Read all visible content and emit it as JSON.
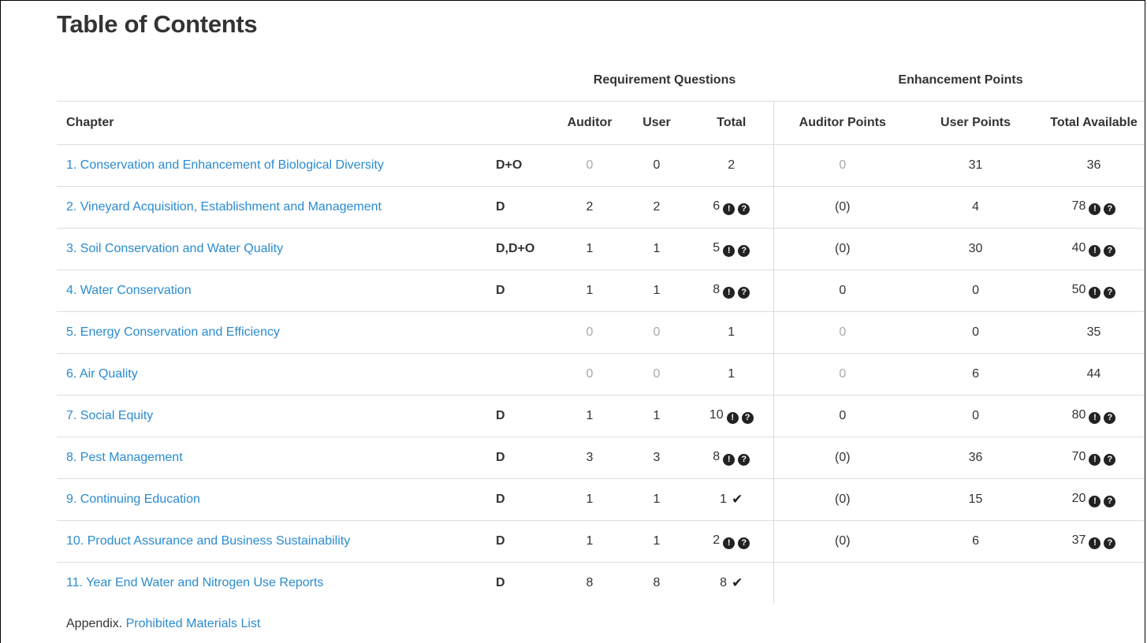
{
  "page": {
    "title": "Table of Contents"
  },
  "groups": {
    "requirement": "Requirement Questions",
    "enhancement": "Enhancement Points"
  },
  "columns": {
    "chapter": "Chapter",
    "auditor": "Auditor",
    "user": "User",
    "total": "Total",
    "auditor_points": "Auditor Points",
    "user_points": "User Points",
    "total_available": "Total Available"
  },
  "rows": [
    {
      "num": "1.",
      "title": "Conservation and Enhancement of Biological Diversity",
      "cat": "D+O",
      "auditor": {
        "v": "0",
        "muted": true
      },
      "user": {
        "v": "0",
        "muted": false
      },
      "total": {
        "v": "2",
        "icons": []
      },
      "aud_pts": {
        "v": "0",
        "muted": true
      },
      "user_pts": "31",
      "tot_av": {
        "v": "36",
        "icons": []
      }
    },
    {
      "num": "2.",
      "title": "Vineyard Acquisition, Establishment and Management",
      "cat": "D",
      "auditor": {
        "v": "2",
        "muted": false
      },
      "user": {
        "v": "2",
        "muted": false
      },
      "total": {
        "v": "6",
        "icons": [
          "exclamation-icon",
          "question-icon"
        ]
      },
      "aud_pts": {
        "v": "(0)",
        "muted": false
      },
      "user_pts": "4",
      "tot_av": {
        "v": "78",
        "icons": [
          "exclamation-icon",
          "question-icon"
        ]
      }
    },
    {
      "num": "3.",
      "title": "Soil Conservation and Water Quality",
      "cat": "D,D+O",
      "auditor": {
        "v": "1",
        "muted": false
      },
      "user": {
        "v": "1",
        "muted": false
      },
      "total": {
        "v": "5",
        "icons": [
          "exclamation-icon",
          "question-icon"
        ]
      },
      "aud_pts": {
        "v": "(0)",
        "muted": false
      },
      "user_pts": "30",
      "tot_av": {
        "v": "40",
        "icons": [
          "exclamation-icon",
          "question-icon"
        ]
      }
    },
    {
      "num": "4.",
      "title": "Water Conservation",
      "cat": "D",
      "auditor": {
        "v": "1",
        "muted": false
      },
      "user": {
        "v": "1",
        "muted": false
      },
      "total": {
        "v": "8",
        "icons": [
          "exclamation-icon",
          "question-icon"
        ]
      },
      "aud_pts": {
        "v": "0",
        "muted": false
      },
      "user_pts": "0",
      "tot_av": {
        "v": "50",
        "icons": [
          "exclamation-icon",
          "question-icon"
        ]
      }
    },
    {
      "num": "5.",
      "title": "Energy Conservation and Efficiency",
      "cat": "",
      "auditor": {
        "v": "0",
        "muted": true
      },
      "user": {
        "v": "0",
        "muted": true
      },
      "total": {
        "v": "1",
        "icons": []
      },
      "aud_pts": {
        "v": "0",
        "muted": true
      },
      "user_pts": "0",
      "tot_av": {
        "v": "35",
        "icons": []
      }
    },
    {
      "num": "6.",
      "title": "Air Quality",
      "cat": "",
      "auditor": {
        "v": "0",
        "muted": true
      },
      "user": {
        "v": "0",
        "muted": true
      },
      "total": {
        "v": "1",
        "icons": []
      },
      "aud_pts": {
        "v": "0",
        "muted": true
      },
      "user_pts": "6",
      "tot_av": {
        "v": "44",
        "icons": []
      }
    },
    {
      "num": "7.",
      "title": "Social Equity",
      "cat": "D",
      "auditor": {
        "v": "1",
        "muted": false
      },
      "user": {
        "v": "1",
        "muted": false
      },
      "total": {
        "v": "10",
        "icons": [
          "exclamation-icon",
          "question-icon"
        ]
      },
      "aud_pts": {
        "v": "0",
        "muted": false
      },
      "user_pts": "0",
      "tot_av": {
        "v": "80",
        "icons": [
          "exclamation-icon",
          "question-icon"
        ]
      }
    },
    {
      "num": "8.",
      "title": "Pest Management",
      "cat": "D",
      "auditor": {
        "v": "3",
        "muted": false
      },
      "user": {
        "v": "3",
        "muted": false
      },
      "total": {
        "v": "8",
        "icons": [
          "exclamation-icon",
          "question-icon"
        ]
      },
      "aud_pts": {
        "v": "(0)",
        "muted": false
      },
      "user_pts": "36",
      "tot_av": {
        "v": "70",
        "icons": [
          "exclamation-icon",
          "question-icon"
        ]
      }
    },
    {
      "num": "9.",
      "title": "Continuing Education",
      "cat": "D",
      "auditor": {
        "v": "1",
        "muted": false
      },
      "user": {
        "v": "1",
        "muted": false
      },
      "total": {
        "v": "1",
        "icons": [
          "check-icon"
        ]
      },
      "aud_pts": {
        "v": "(0)",
        "muted": false
      },
      "user_pts": "15",
      "tot_av": {
        "v": "20",
        "icons": [
          "exclamation-icon",
          "question-icon"
        ]
      }
    },
    {
      "num": "10.",
      "title": "Product Assurance and Business Sustainability",
      "cat": "D",
      "auditor": {
        "v": "1",
        "muted": false
      },
      "user": {
        "v": "1",
        "muted": false
      },
      "total": {
        "v": "2",
        "icons": [
          "exclamation-icon",
          "question-icon"
        ]
      },
      "aud_pts": {
        "v": "(0)",
        "muted": false
      },
      "user_pts": "6",
      "tot_av": {
        "v": "37",
        "icons": [
          "exclamation-icon",
          "question-icon"
        ]
      }
    },
    {
      "num": "11.",
      "title": "Year End Water and Nitrogen Use Reports",
      "cat": "D",
      "auditor": {
        "v": "8",
        "muted": false
      },
      "user": {
        "v": "8",
        "muted": false
      },
      "total": {
        "v": "8",
        "icons": [
          "check-icon"
        ]
      },
      "aud_pts": {
        "v": "",
        "muted": false
      },
      "user_pts": "",
      "tot_av": {
        "v": "",
        "icons": []
      }
    }
  ],
  "appendix": {
    "label": "Appendix.",
    "link": "Prohibited Materials List"
  },
  "colors": {
    "link": "#2a8bd0",
    "muted": "#aaaaaa",
    "border": "#dddddd"
  }
}
